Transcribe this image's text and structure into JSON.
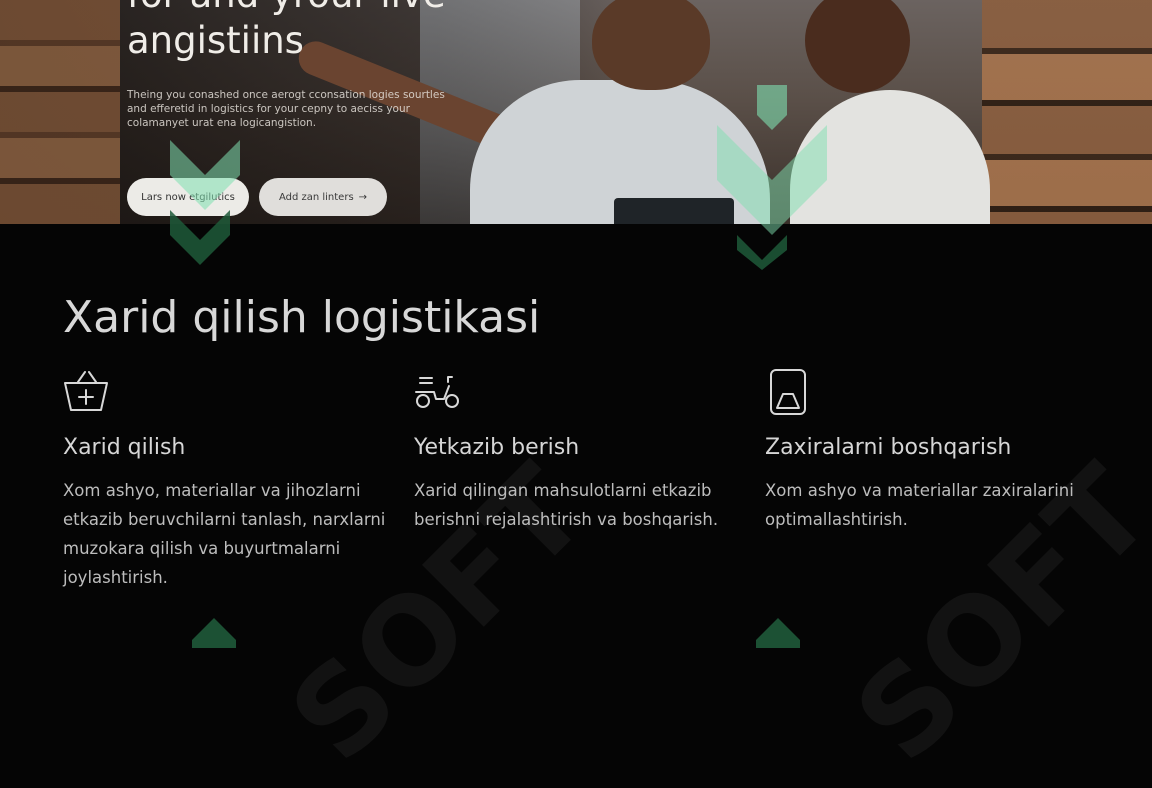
{
  "hero": {
    "title": "for and yrour live\nangistiins",
    "description": "Theing you conashed once aerogt cconsation logies sourtles and efferetid in logistics for your cepny to aeciss your colamanyet urat ena logicangistion.",
    "primary_button": "Lars now etgilutics",
    "secondary_button": "Add zan linters",
    "secondary_button_arrow": "→"
  },
  "section": {
    "title": "Xarid qilish logistikasi",
    "features": [
      {
        "icon": "shopping-basket-icon",
        "title": "Xarid qilish",
        "description": "Xom ashyo, materiallar va jihozlarni etkazib beruvchilarni tanlash, narxlarni muzokara qilish va buyurtmalarni joylashtirish."
      },
      {
        "icon": "delivery-scooter-icon",
        "title": "Yetkazib berish",
        "description": "Xarid qilingan mahsulotlarni etkazib berishni rejalashtirish va boshqarish."
      },
      {
        "icon": "inventory-box-icon",
        "title": "Zaxiralarni boshqarish",
        "description": "Xom ashyo va materiallar zaxiralarini optimallashtirish."
      }
    ]
  },
  "watermark": {
    "text": "SOFT"
  },
  "colors": {
    "background": "#050505",
    "watermark_green": "#1f5a3a",
    "watermark_light_green": "#7fe0b0"
  }
}
